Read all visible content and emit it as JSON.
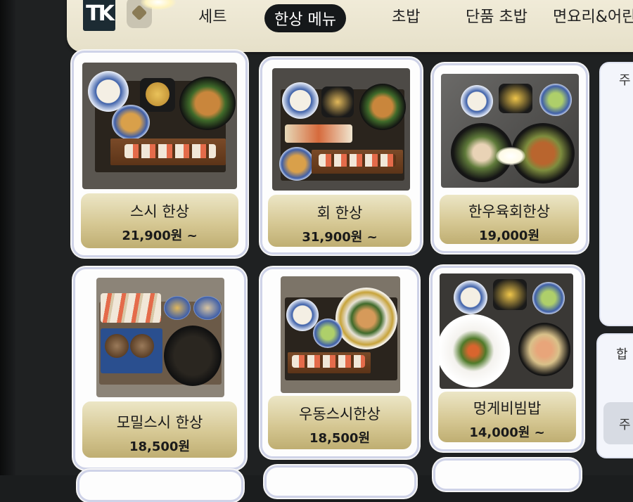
{
  "nav": {
    "logo_text": "TK",
    "tabs": [
      {
        "label": "세트"
      },
      {
        "label": "한상 메뉴",
        "active": true
      },
      {
        "label": "초밥"
      },
      {
        "label": "단품 초밥"
      },
      {
        "label": "면요리&어린"
      }
    ]
  },
  "menu": [
    {
      "name": "스시 한상",
      "price": "21,900원 ~"
    },
    {
      "name": "회 한상",
      "price": "31,900원 ~"
    },
    {
      "name": "한우육회한상",
      "price": "19,000원"
    },
    {
      "name": "모밀스시 한상",
      "price": "18,500원"
    },
    {
      "name": "우동스시한상",
      "price": "18,500원"
    },
    {
      "name": "멍게비빔밥",
      "price": "14,000원 ~"
    }
  ],
  "side_panel": {
    "top_label": "주",
    "bottom_label": "합",
    "button_label": "주"
  },
  "colors": {
    "nav_bg": "#efe9d6",
    "label_gold": "#d6c894",
    "active_tab": "#15181a"
  }
}
